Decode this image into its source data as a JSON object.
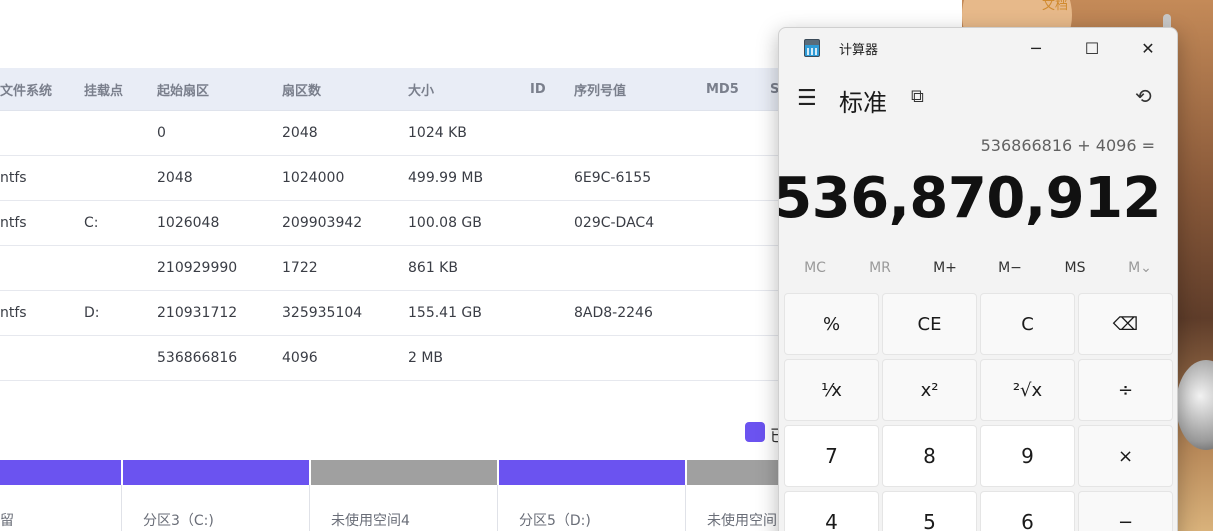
{
  "disk_tool": {
    "columns": [
      "文件系统",
      "挂载点",
      "起始扇区",
      "扇区数",
      "大小",
      "ID",
      "序列号值",
      "MD5",
      "S"
    ],
    "rows": [
      {
        "fs": "",
        "mount": "",
        "start": "0",
        "sectors": "2048",
        "size": "1024 KB",
        "id": "",
        "serial": ""
      },
      {
        "fs": "ntfs",
        "mount": "",
        "start": "2048",
        "sectors": "1024000",
        "size": "499.99 MB",
        "id": "",
        "serial": "6E9C-6155"
      },
      {
        "fs": "ntfs",
        "mount": "C:",
        "start": "1026048",
        "sectors": "209903942",
        "size": "100.08 GB",
        "id": "",
        "serial": "029C-DAC4"
      },
      {
        "fs": "",
        "mount": "",
        "start": "210929990",
        "sectors": "1722",
        "size": "861 KB",
        "id": "",
        "serial": ""
      },
      {
        "fs": "ntfs",
        "mount": "D:",
        "start": "210931712",
        "sectors": "325935104",
        "size": "155.41 GB",
        "id": "",
        "serial": "8AD8-2246"
      },
      {
        "fs": "",
        "mount": "",
        "start": "536866816",
        "sectors": "4096",
        "size": "2 MB",
        "id": "",
        "serial": ""
      }
    ],
    "legend_partial": "已",
    "partitions": [
      {
        "label": "留",
        "color": "#6b53f0"
      },
      {
        "label": "分区3（C:)",
        "color": "#6b53f0"
      },
      {
        "label": "未使用空间4",
        "color": "#a0a0a0"
      },
      {
        "label": "分区5（D:)",
        "color": "#6b53f0"
      },
      {
        "label": "未使用空间6",
        "color": "#a0a0a0"
      }
    ],
    "deco_label": "文档"
  },
  "calculator": {
    "title": "计算器",
    "mode": "标准",
    "expression": "536866816 + 4096 =",
    "result": "536,870,912",
    "window": {
      "minimize": "─",
      "maximize": "☐",
      "close": "✕"
    },
    "icons": {
      "menu": "☰",
      "keep_on_top": "⧉",
      "history": "⟲"
    },
    "memory": [
      "MC",
      "MR",
      "M+",
      "M−",
      "MS",
      "M⌄"
    ],
    "keys": [
      [
        "%",
        "CE",
        "C",
        "⌫"
      ],
      [
        "¹⁄x",
        "x²",
        "²√x",
        "÷"
      ],
      [
        "7",
        "8",
        "9",
        "×"
      ],
      [
        "4",
        "5",
        "6",
        "−"
      ]
    ]
  }
}
